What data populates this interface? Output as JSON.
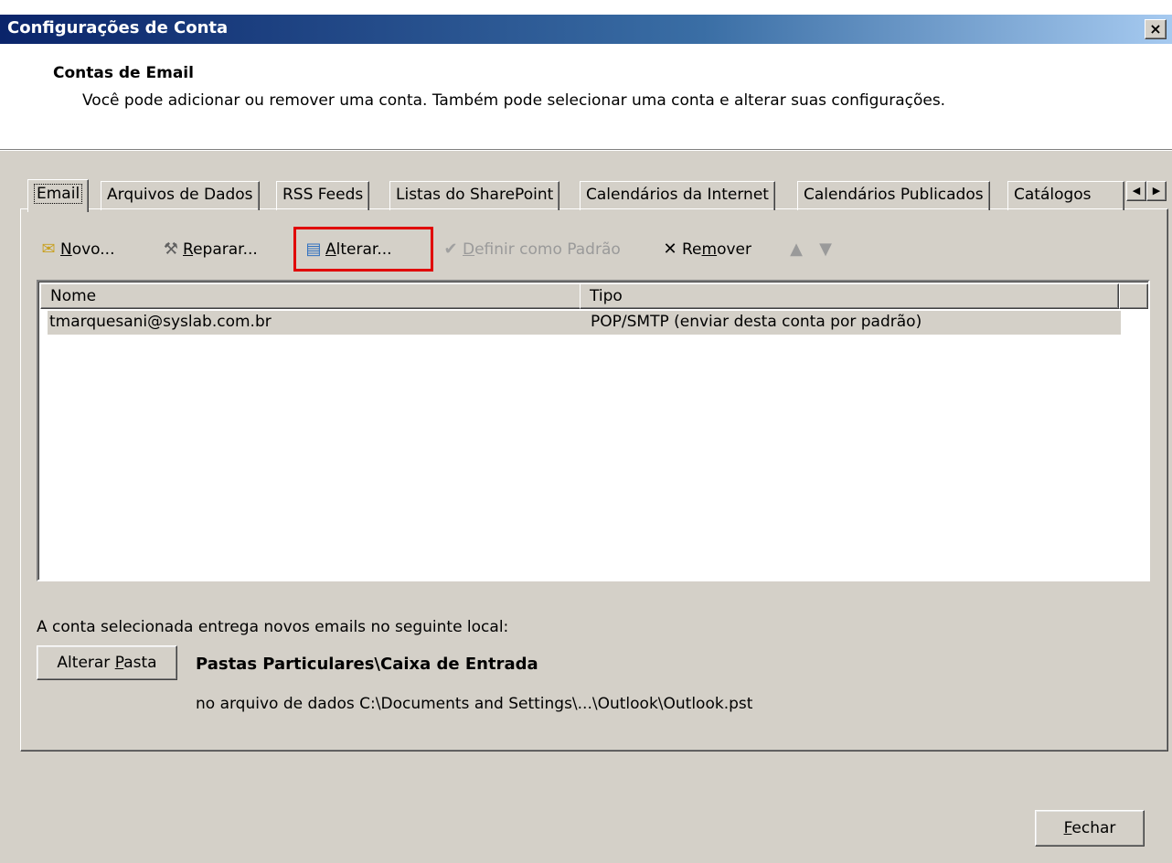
{
  "dialog": {
    "title": "Configurações de Conta",
    "close_glyph": "×"
  },
  "header": {
    "heading": "Contas de Email",
    "description": "Você pode adicionar ou remover uma conta. Também pode selecionar uma conta e alterar suas configurações."
  },
  "tabs": [
    {
      "label": "Email"
    },
    {
      "label": "Arquivos de Dados"
    },
    {
      "label": "RSS Feeds"
    },
    {
      "label": "Listas do SharePoint"
    },
    {
      "label": "Calendários da Internet"
    },
    {
      "label": "Calendários Publicados"
    },
    {
      "label": "Catálogos"
    }
  ],
  "toolbar": {
    "new": {
      "pre": "",
      "key": "N",
      "post": "ovo..."
    },
    "repair": {
      "pre": "",
      "key": "R",
      "post": "eparar..."
    },
    "change": {
      "pre": "",
      "key": "A",
      "post": "lterar..."
    },
    "set_default": {
      "pre": "",
      "key": "D",
      "post": "efinir como Padrão"
    },
    "remove": {
      "pre": "Re",
      "key": "m",
      "post": "over"
    }
  },
  "accounts": {
    "columns": [
      "Nome",
      "Tipo"
    ],
    "rows": [
      {
        "name": "tmarquesani@syslab.com.br",
        "type": "POP/SMTP (enviar desta conta por padrão)"
      }
    ]
  },
  "delivery": {
    "info": "A conta selecionada entrega novos emails no seguinte local:",
    "change_folder": {
      "pre": "Alterar ",
      "key": "P",
      "post": "asta"
    },
    "folder_name": "Pastas Particulares\\Caixa de Entrada",
    "folder_path": "no arquivo de dados C:\\Documents and Settings\\...\\Outlook\\Outlook.pst"
  },
  "footer": {
    "close": {
      "pre": "",
      "key": "F",
      "post": "echar"
    }
  },
  "colors": {
    "highlight_box": "#e00000",
    "titlebar": "#0a246a"
  }
}
